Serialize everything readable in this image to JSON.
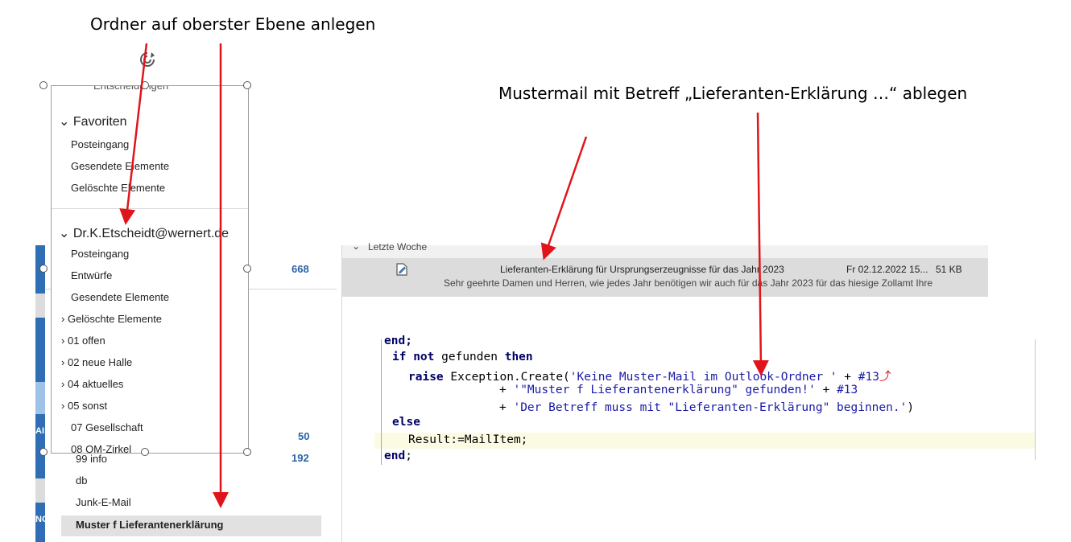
{
  "callouts": {
    "top_left": "Ordner auf oberster Ebene anlegen",
    "top_right": "Mustermail mit Betreff „Lieferanten-Erklärung …“ ablegen"
  },
  "popout": {
    "top_partial": "Entscheidungen",
    "favorites": {
      "label": "Favoriten",
      "items": [
        "Posteingang",
        "Gesendete Elemente",
        "Gelöschte Elemente"
      ]
    },
    "account": {
      "label": "Dr.K.Etscheidt@wernert.de",
      "items": [
        "Posteingang",
        "Entwürfe",
        "Gesendete Elemente",
        "Gelöschte Elemente",
        "01 offen",
        "02 neue Halle",
        "04 aktuelles",
        "05 sonst",
        "07 Gesellschaft",
        "08 QM-Zirkel"
      ]
    }
  },
  "folder_pane": {
    "counts": [
      "668",
      "50",
      "192"
    ],
    "items": [
      "99 info",
      "db",
      "Junk-E-Mail",
      "Muster f Lieferantenerklärung"
    ]
  },
  "mail_list": {
    "group_label": "Letzte Woche",
    "item": {
      "subject": "Lieferanten-Erklärung für Ursprungserzeugnisse für das Jahr 2023",
      "date": "Fr 02.12.2022 15...",
      "size": "51 KB",
      "preview": "Sehr geehrte Damen und Herren,  wie jedes Jahr benötigen wir auch für das Jahr 2023  für das hiesige Zollamt Ihre"
    }
  },
  "code": {
    "l0": "end;",
    "l1_kw1": "if",
    "l1_kw2": "not",
    "l1_mid": " gefunden ",
    "l1_kw3": "then",
    "l2_kw": "raise",
    "l2_mid": " Exception.Create(",
    "l2_str": "'Keine Muster-Mail im Outlook-Ordner '",
    "l2_plus": " + ",
    "l2_num": "#13",
    "l3_plus": "+ ",
    "l3_str": "'\"Muster f Lieferantenerklärung\" gefunden!'",
    "l3_plus2": " + ",
    "l3_num": "#13",
    "l4_plus": "+ ",
    "l4_str": "'Der Betreff muss mit \"Lieferanten-Erklärung\" beginnen.'",
    "l4_end": ")",
    "l5_kw": "else",
    "l6": "Result:=MailItem;",
    "l7_kw": "end",
    "l7_end": ";"
  },
  "desktop_strip": [
    "AI",
    "NC"
  ],
  "colors": {
    "arrow": "#e0151b",
    "count": "#2b62a6",
    "code_keyword": "#000066",
    "code_string": "#1a1aa6"
  }
}
